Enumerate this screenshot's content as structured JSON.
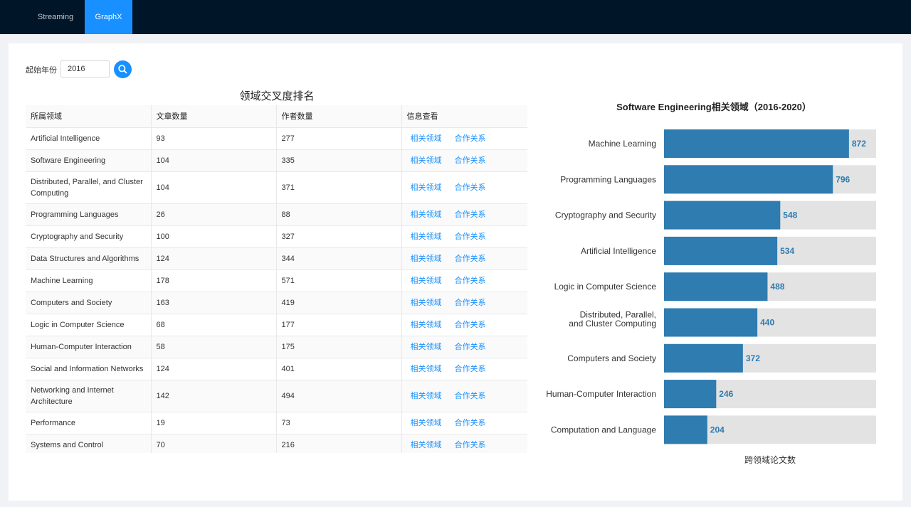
{
  "nav": {
    "tabs": [
      {
        "label": "Streaming",
        "active": false
      },
      {
        "label": "GraphX",
        "active": true
      }
    ]
  },
  "filter": {
    "label": "起始年份",
    "year_value": "2016",
    "search_icon": "search-icon"
  },
  "table": {
    "title": "领域交叉度排名",
    "columns": [
      "所属领域",
      "文章数量",
      "作者数量",
      "信息查看"
    ],
    "link_labels": {
      "related": "相关领域",
      "collab": "合作关系"
    },
    "rows": [
      [
        "Artificial Intelligence",
        "93",
        "277"
      ],
      [
        "Software Engineering",
        "104",
        "335"
      ],
      [
        "Distributed, Parallel, and Cluster Computing",
        "104",
        "371"
      ],
      [
        "Programming Languages",
        "26",
        "88"
      ],
      [
        "Cryptography and Security",
        "100",
        "327"
      ],
      [
        "Data Structures and Algorithms",
        "124",
        "344"
      ],
      [
        "Machine Learning",
        "178",
        "571"
      ],
      [
        "Computers and Society",
        "163",
        "419"
      ],
      [
        "Logic in Computer Science",
        "68",
        "177"
      ],
      [
        "Human-Computer Interaction",
        "58",
        "175"
      ],
      [
        "Social and Information Networks",
        "124",
        "401"
      ],
      [
        "Networking and Internet Architecture",
        "142",
        "494"
      ],
      [
        "Performance",
        "19",
        "73"
      ],
      [
        "Systems and Control",
        "70",
        "216"
      ]
    ]
  },
  "chart_data": {
    "type": "bar",
    "orientation": "horizontal",
    "title": "Software Engineering相关领域（2016-2020）",
    "xlabel": "跨领域论文数",
    "ylabel": "",
    "categories": [
      "Machine Learning",
      "Programming Languages",
      "Cryptography and Security",
      "Artificial Intelligence",
      "Logic in Computer Science",
      "Distributed, Parallel, and Cluster Computing",
      "Computers and Society",
      "Human-Computer Interaction",
      "Computation and Language"
    ],
    "category_lines": [
      [
        "Machine Learning"
      ],
      [
        "Programming Languages"
      ],
      [
        "Cryptography and Security"
      ],
      [
        "Artificial Intelligence"
      ],
      [
        "Logic in Computer Science"
      ],
      [
        "Distributed, Parallel,",
        "and Cluster Computing"
      ],
      [
        "Computers and Society"
      ],
      [
        "Human-Computer Interaction"
      ],
      [
        "Computation and Language"
      ]
    ],
    "values": [
      872,
      796,
      548,
      534,
      488,
      440,
      372,
      246,
      204
    ],
    "xlim": [
      0,
      1000
    ],
    "colors": {
      "bar": "#2e7cb0",
      "track": "#e3e3e3",
      "label": "#2e7cb0"
    }
  },
  "colors": {
    "topbar": "#011529",
    "accent": "#1890ff",
    "link": "#1890ff"
  }
}
